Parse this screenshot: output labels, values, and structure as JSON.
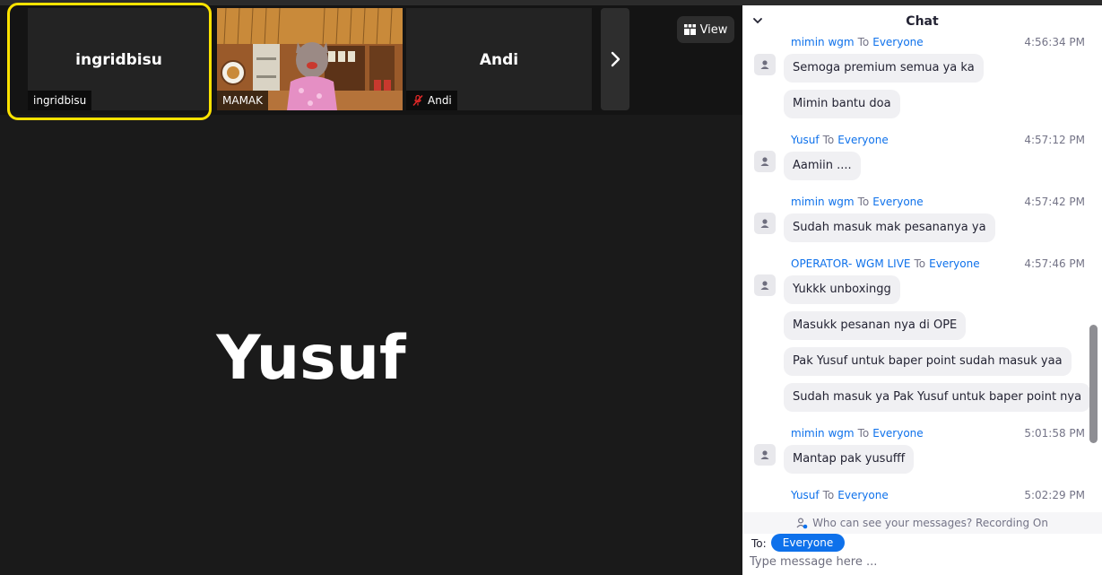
{
  "participants": {
    "tile1": {
      "name": "ingridbisu",
      "label": "ingridbisu"
    },
    "tile2": {
      "label": "MAMAK"
    },
    "tile3": {
      "name": "Andi",
      "label": "Andi"
    }
  },
  "view_label": "View",
  "main_speaker": "Yusuf",
  "chat": {
    "title": "Chat",
    "messages": [
      {
        "sender": "mimin wgm",
        "to": "To",
        "recipient": "Everyone",
        "time": "4:56:34 PM"
      },
      {
        "text": "Semoga premium semua ya ka"
      },
      {
        "text": "Mimin bantu doa"
      },
      {
        "sender": "Yusuf",
        "to": "To",
        "recipient": "Everyone",
        "time": "4:57:12 PM"
      },
      {
        "text": "Aamiin ...."
      },
      {
        "sender": "mimin wgm",
        "to": "To",
        "recipient": "Everyone",
        "time": "4:57:42 PM"
      },
      {
        "text": "Sudah masuk mak pesananya ya"
      },
      {
        "sender": "OPERATOR- WGM LIVE",
        "to": "To",
        "recipient": "Everyone",
        "time": "4:57:46 PM"
      },
      {
        "text": "Yukkk unboxingg"
      },
      {
        "text": "Masukk pesanan nya di OPE"
      },
      {
        "text": "Pak Yusuf untuk baper point sudah masuk yaa"
      },
      {
        "text": "Sudah masuk ya Pak Yusuf untuk baper point nya"
      },
      {
        "sender": "mimin wgm",
        "to": "To",
        "recipient": "Everyone",
        "time": "5:01:58 PM"
      },
      {
        "text": "Mantap pak yusufff"
      },
      {
        "sender": "Yusuf",
        "to": "To",
        "recipient": "Everyone",
        "time": "5:02:29 PM"
      }
    ],
    "who_can_see": "Who can see your messages? Recording On",
    "to_label": "To:",
    "to_value": "Everyone",
    "input_placeholder": "Type message here ..."
  },
  "colors": {
    "accent": "#0e71eb",
    "active_speaker": "#ffe300"
  }
}
